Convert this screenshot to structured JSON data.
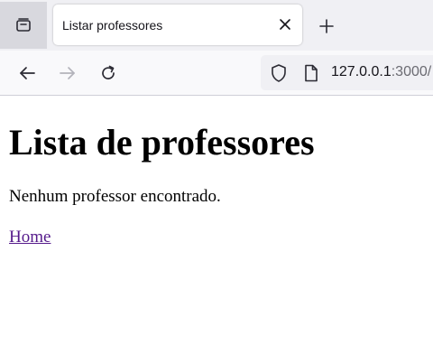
{
  "browser": {
    "tab_title": "Listar professores",
    "url_host": "127.0.0.1",
    "url_rest": ":3000/",
    "icons": {
      "tab_overview": "tab-overview-icon",
      "close": "close-icon",
      "new_tab": "plus-icon",
      "back": "arrow-left-icon",
      "forward": "arrow-right-icon",
      "reload": "reload-icon",
      "shield": "shield-icon",
      "page": "page-icon"
    }
  },
  "page": {
    "heading": "Lista de professores",
    "message": "Nenhum professor encontrado.",
    "home_link": "Home"
  },
  "colors": {
    "link_visited": "#551a8b",
    "tabstrip_bg": "#f0f0f4",
    "toolbar_bg": "#f9f9fb"
  }
}
